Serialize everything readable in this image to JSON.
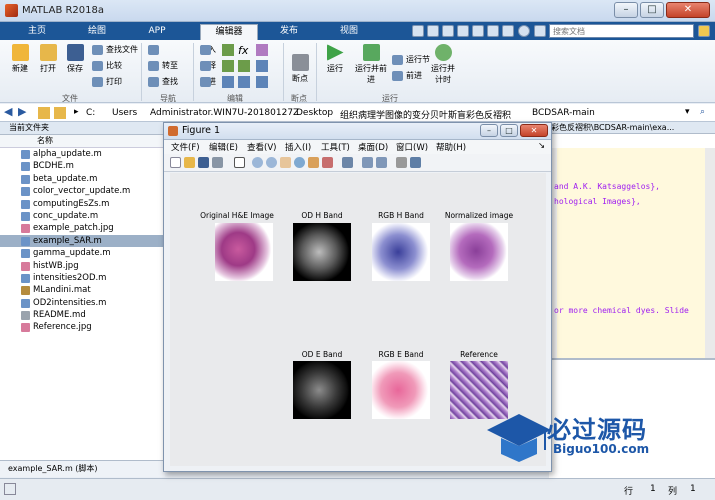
{
  "window": {
    "title": "MATLAB R2018a"
  },
  "tabs": [
    "主页",
    "绘图",
    "APP",
    "编辑器",
    "发布",
    "视图"
  ],
  "search": {
    "placeholder": "搜索文档"
  },
  "ribbon": {
    "file_group": {
      "new": "新建",
      "open": "打开",
      "save": "保存",
      "find_files": "查找文件",
      "compare": "比较",
      "print": "打印",
      "label": "文件"
    },
    "nav_group": {
      "goto": "转至",
      "find": "查找",
      "label": "导航"
    },
    "edit_group": {
      "insert": "插入",
      "comment": "注释",
      "indent": "缩进",
      "label": "编辑"
    },
    "bp_group": {
      "breakpoints": "断点",
      "label": "断点"
    },
    "run_group": {
      "run": "运行",
      "run_advance": "运行并前进",
      "run_section": "运行节",
      "advance": "前进",
      "run_time": "运行并计时",
      "label": "运行"
    }
  },
  "address": {
    "crumbs": [
      "C:",
      "Users",
      "Administrator.WIN7U-20180127Z",
      "Desktop",
      "组织病理学图像的变分贝叶斯盲彩色反褶积",
      "BCDSAR-main"
    ]
  },
  "files": {
    "panel_title": "当前文件夹",
    "column_name": "名称",
    "items": [
      "alpha_update.m",
      "BCDHE.m",
      "beta_update.m",
      "color_vector_update.m",
      "computingEsZs.m",
      "conc_update.m",
      "example_patch.jpg",
      "example_SAR.m",
      "gamma_update.m",
      "histWB.jpg",
      "intensities2OD.m",
      "MLandini.mat",
      "OD2intensities.m",
      "README.md",
      "Reference.jpg"
    ],
    "selected": "example_SAR.m",
    "status": "example_SAR.m  (脚本)"
  },
  "editor": {
    "path": "彩色反褶积\\BCDSAR-main\\exa...",
    "lines": [
      "and A.K. Katsaggelos},",
      "hological Images},",
      "or more chemical dyes. Slide"
    ]
  },
  "figure": {
    "title": "Figure 1",
    "menu": [
      "文件(F)",
      "编辑(E)",
      "查看(V)",
      "插入(I)",
      "工具(T)",
      "桌面(D)",
      "窗口(W)",
      "帮助(H)"
    ],
    "panels": [
      {
        "label": "Original H&E Image"
      },
      {
        "label": "OD H Band"
      },
      {
        "label": "RGB H Band"
      },
      {
        "label": "Normalized image"
      },
      {
        "label": "OD E Band"
      },
      {
        "label": "RGB E Band"
      },
      {
        "label": "Reference"
      }
    ]
  },
  "status": {
    "row_label": "行",
    "row": "1",
    "col_label": "列",
    "col": "1"
  },
  "watermark": {
    "title": "必过源码",
    "url": "Biguo100.com"
  }
}
